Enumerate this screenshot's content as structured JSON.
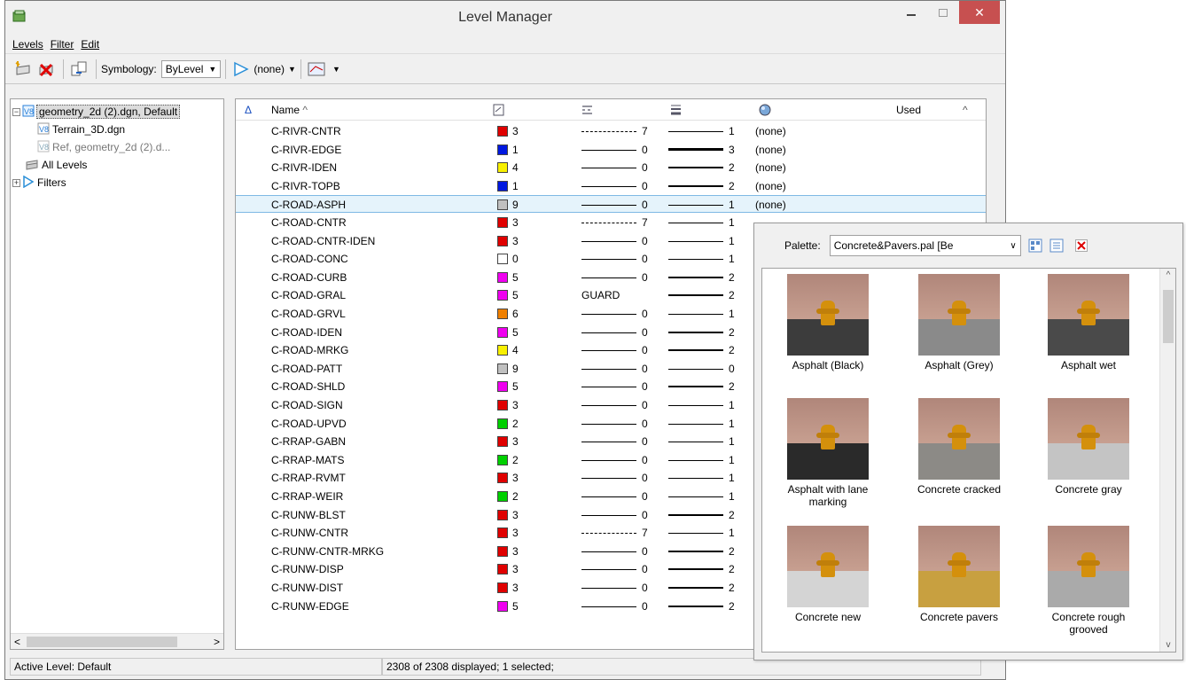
{
  "window": {
    "title": "Level Manager"
  },
  "menu": {
    "levels": "Levels",
    "filter": "Filter",
    "edit": "Edit"
  },
  "toolbar": {
    "symbology_label": "Symbology:",
    "symbology_value": "ByLevel",
    "filter_value": "(none)"
  },
  "tree": {
    "root": "geometry_2d (2).dgn, Default",
    "child1": "Terrain_3D.dgn",
    "child2": "Ref, geometry_2d (2).d...",
    "all_levels": "All Levels",
    "filters": "Filters"
  },
  "list": {
    "headers": {
      "name": "Name",
      "used": "Used"
    },
    "rows": [
      {
        "name": "C-RIVR-CNTR",
        "color": "#e00000",
        "color_idx": "3",
        "style": "dash",
        "style_num": "7",
        "weight": 1,
        "weight_num": "1",
        "material": "(none)"
      },
      {
        "name": "C-RIVR-EDGE",
        "color": "#0018e0",
        "color_idx": "1",
        "style": "solid",
        "style_num": "0",
        "weight": 3,
        "weight_num": "3",
        "material": "(none)"
      },
      {
        "name": "C-RIVR-IDEN",
        "color": "#f8f000",
        "color_idx": "4",
        "style": "solid",
        "style_num": "0",
        "weight": 2,
        "weight_num": "2",
        "material": "(none)"
      },
      {
        "name": "C-RIVR-TOPB",
        "color": "#0018e0",
        "color_idx": "1",
        "style": "solid",
        "style_num": "0",
        "weight": 2,
        "weight_num": "2",
        "material": "(none)"
      },
      {
        "name": "C-ROAD-ASPH",
        "color": "#c0c0c0",
        "color_idx": "9",
        "style": "solid",
        "style_num": "0",
        "weight": 1,
        "weight_num": "1",
        "material": "(none)"
      },
      {
        "name": "C-ROAD-CNTR",
        "color": "#e00000",
        "color_idx": "3",
        "style": "dash",
        "style_num": "7",
        "weight": 1,
        "weight_num": "1",
        "material": ""
      },
      {
        "name": "C-ROAD-CNTR-IDEN",
        "color": "#e00000",
        "color_idx": "3",
        "style": "solid",
        "style_num": "0",
        "weight": 1,
        "weight_num": "1",
        "material": ""
      },
      {
        "name": "C-ROAD-CONC",
        "color": "#ffffff",
        "color_idx": "0",
        "style": "solid",
        "style_num": "0",
        "weight": 1,
        "weight_num": "1",
        "material": ""
      },
      {
        "name": "C-ROAD-CURB",
        "color": "#f000f0",
        "color_idx": "5",
        "style": "solid",
        "style_num": "0",
        "weight": 2,
        "weight_num": "2",
        "material": ""
      },
      {
        "name": "C-ROAD-GRAL",
        "color": "#f000f0",
        "color_idx": "5",
        "style": "text",
        "style_num": "GUARD",
        "weight": 2,
        "weight_num": "2",
        "material": ""
      },
      {
        "name": "C-ROAD-GRVL",
        "color": "#f08000",
        "color_idx": "6",
        "style": "solid",
        "style_num": "0",
        "weight": 1,
        "weight_num": "1",
        "material": ""
      },
      {
        "name": "C-ROAD-IDEN",
        "color": "#f000f0",
        "color_idx": "5",
        "style": "solid",
        "style_num": "0",
        "weight": 2,
        "weight_num": "2",
        "material": ""
      },
      {
        "name": "C-ROAD-MRKG",
        "color": "#f8f000",
        "color_idx": "4",
        "style": "solid",
        "style_num": "0",
        "weight": 2,
        "weight_num": "2",
        "material": ""
      },
      {
        "name": "C-ROAD-PATT",
        "color": "#c0c0c0",
        "color_idx": "9",
        "style": "solid",
        "style_num": "0",
        "weight": 0,
        "weight_num": "0",
        "material": ""
      },
      {
        "name": "C-ROAD-SHLD",
        "color": "#f000f0",
        "color_idx": "5",
        "style": "solid",
        "style_num": "0",
        "weight": 2,
        "weight_num": "2",
        "material": ""
      },
      {
        "name": "C-ROAD-SIGN",
        "color": "#e00000",
        "color_idx": "3",
        "style": "solid",
        "style_num": "0",
        "weight": 1,
        "weight_num": "1",
        "material": ""
      },
      {
        "name": "C-ROAD-UPVD",
        "color": "#00d000",
        "color_idx": "2",
        "style": "solid",
        "style_num": "0",
        "weight": 1,
        "weight_num": "1",
        "material": ""
      },
      {
        "name": "C-RRAP-GABN",
        "color": "#e00000",
        "color_idx": "3",
        "style": "solid",
        "style_num": "0",
        "weight": 1,
        "weight_num": "1",
        "material": ""
      },
      {
        "name": "C-RRAP-MATS",
        "color": "#00d000",
        "color_idx": "2",
        "style": "solid",
        "style_num": "0",
        "weight": 1,
        "weight_num": "1",
        "material": ""
      },
      {
        "name": "C-RRAP-RVMT",
        "color": "#e00000",
        "color_idx": "3",
        "style": "solid",
        "style_num": "0",
        "weight": 1,
        "weight_num": "1",
        "material": ""
      },
      {
        "name": "C-RRAP-WEIR",
        "color": "#00d000",
        "color_idx": "2",
        "style": "solid",
        "style_num": "0",
        "weight": 1,
        "weight_num": "1",
        "material": ""
      },
      {
        "name": "C-RUNW-BLST",
        "color": "#e00000",
        "color_idx": "3",
        "style": "solid",
        "style_num": "0",
        "weight": 2,
        "weight_num": "2",
        "material": ""
      },
      {
        "name": "C-RUNW-CNTR",
        "color": "#e00000",
        "color_idx": "3",
        "style": "dash",
        "style_num": "7",
        "weight": 1,
        "weight_num": "1",
        "material": ""
      },
      {
        "name": "C-RUNW-CNTR-MRKG",
        "color": "#e00000",
        "color_idx": "3",
        "style": "solid",
        "style_num": "0",
        "weight": 2,
        "weight_num": "2",
        "material": ""
      },
      {
        "name": "C-RUNW-DISP",
        "color": "#e00000",
        "color_idx": "3",
        "style": "solid",
        "style_num": "0",
        "weight": 2,
        "weight_num": "2",
        "material": ""
      },
      {
        "name": "C-RUNW-DIST",
        "color": "#e00000",
        "color_idx": "3",
        "style": "solid",
        "style_num": "0",
        "weight": 2,
        "weight_num": "2",
        "material": ""
      },
      {
        "name": "C-RUNW-EDGE",
        "color": "#f000f0",
        "color_idx": "5",
        "style": "solid",
        "style_num": "0",
        "weight": 2,
        "weight_num": "2",
        "material": ""
      }
    ]
  },
  "status": {
    "active_level": "Active Level: Default",
    "count": "2308 of 2308 displayed; 1 selected;"
  },
  "palette": {
    "label": "Palette:",
    "file": "Concrete&Pavers.pal [Be",
    "materials": [
      {
        "name": "Asphalt (Black)",
        "floor": "#3c3c3c"
      },
      {
        "name": "Asphalt (Grey)",
        "floor": "#8a8a8a"
      },
      {
        "name": "Asphalt wet",
        "floor": "#4a4a4a"
      },
      {
        "name": "Asphalt with lane marking",
        "floor": "#2a2a2a"
      },
      {
        "name": "Concrete cracked",
        "floor": "#8c8a86"
      },
      {
        "name": "Concrete gray",
        "floor": "#c4c4c4"
      },
      {
        "name": "Concrete new",
        "floor": "#d4d4d4"
      },
      {
        "name": "Concrete pavers",
        "floor": "#c8a040"
      },
      {
        "name": "Concrete rough grooved",
        "floor": "#aaaaaa"
      }
    ]
  }
}
